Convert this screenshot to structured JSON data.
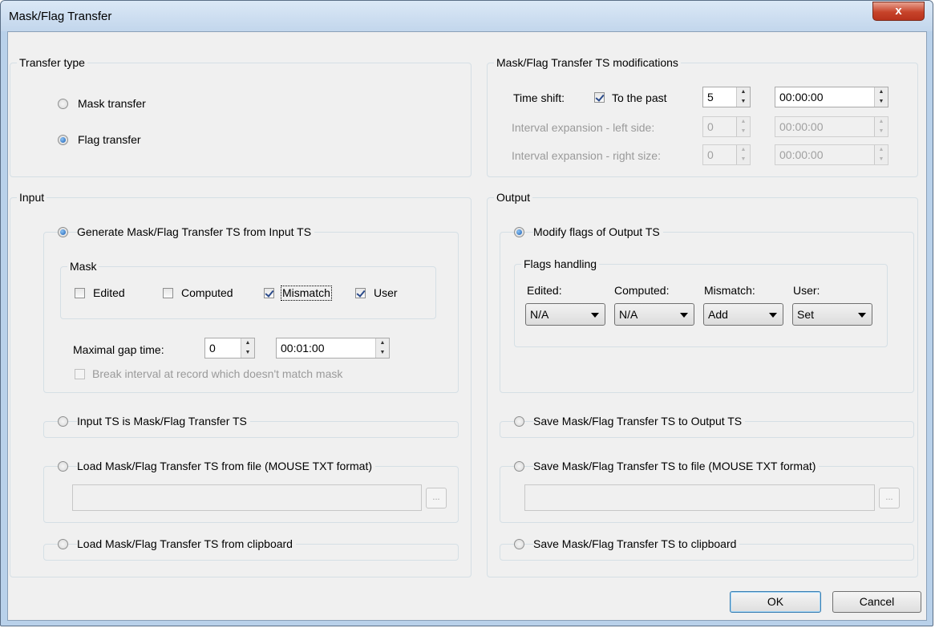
{
  "window": {
    "title": "Mask/Flag Transfer",
    "close_glyph": "x"
  },
  "transfer_type": {
    "label": "Transfer type",
    "mask_transfer": "Mask transfer",
    "flag_transfer": "Flag transfer",
    "selected": "flag_transfer"
  },
  "modifications": {
    "label": "Mask/Flag Transfer TS modifications",
    "time_shift_label": "Time shift:",
    "to_the_past_label": "To the past",
    "to_the_past_checked": true,
    "time_shift_value": "5",
    "time_shift_time": "00:00:00",
    "left_label": "Interval expansion - left side:",
    "left_value": "0",
    "left_time": "00:00:00",
    "right_label": "Interval expansion - right size:",
    "right_value": "0",
    "right_time": "00:00:00"
  },
  "input": {
    "label": "Input",
    "generate_label": "Generate Mask/Flag Transfer TS from Input TS",
    "mask_label": "Mask",
    "edited_label": "Edited",
    "computed_label": "Computed",
    "mismatch_label": "Mismatch",
    "user_label": "User",
    "edited_checked": false,
    "computed_checked": false,
    "mismatch_checked": true,
    "user_checked": true,
    "max_gap_label": "Maximal gap time:",
    "max_gap_value": "0",
    "max_gap_time": "00:01:00",
    "break_label": "Break interval at record which doesn't match mask",
    "input_is_label": "Input TS is Mask/Flag Transfer TS",
    "load_file_label": "Load Mask/Flag Transfer TS from file (MOUSE TXT format)",
    "load_file_path": "",
    "browse_label": "...",
    "load_clipboard_label": "Load Mask/Flag Transfer TS from clipboard"
  },
  "output": {
    "label": "Output",
    "modify_label": "Modify flags of Output TS",
    "flags_handling_label": "Flags handling",
    "edited_label": "Edited:",
    "computed_label": "Computed:",
    "mismatch_label": "Mismatch:",
    "user_label": "User:",
    "edited_value": "N/A",
    "computed_value": "N/A",
    "mismatch_value": "Add",
    "user_value": "Set",
    "save_output_label": "Save Mask/Flag Transfer TS to Output TS",
    "save_file_label": "Save Mask/Flag Transfer TS to file (MOUSE TXT format)",
    "save_file_path": "",
    "browse_label": "...",
    "save_clipboard_label": "Save Mask/Flag Transfer TS to clipboard"
  },
  "buttons": {
    "ok": "OK",
    "cancel": "Cancel"
  },
  "colors": {
    "title_bar": "#c2d6ec",
    "dialog_bg": "#f0f0f0",
    "close_button": "#c7432a"
  }
}
